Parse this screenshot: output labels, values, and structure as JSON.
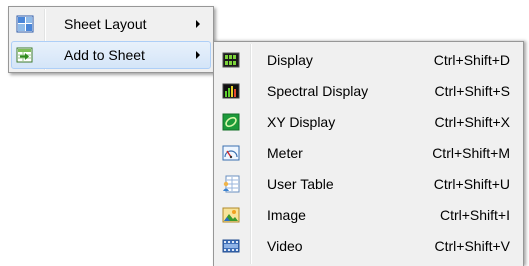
{
  "main_menu": {
    "items": [
      {
        "label": "Sheet Layout",
        "icon": "sheet-layout-icon",
        "has_submenu": true
      },
      {
        "label": "Add to Sheet",
        "icon": "add-to-sheet-icon",
        "has_submenu": true,
        "highlighted": true
      }
    ]
  },
  "submenu": {
    "items": [
      {
        "label": "Display",
        "shortcut": "Ctrl+Shift+D",
        "icon": "display-icon"
      },
      {
        "label": "Spectral Display",
        "shortcut": "Ctrl+Shift+S",
        "icon": "spectral-display-icon"
      },
      {
        "label": "XY Display",
        "shortcut": "Ctrl+Shift+X",
        "icon": "xy-display-icon"
      },
      {
        "label": "Meter",
        "shortcut": "Ctrl+Shift+M",
        "icon": "meter-icon"
      },
      {
        "label": "User Table",
        "shortcut": "Ctrl+Shift+U",
        "icon": "user-table-icon"
      },
      {
        "label": "Image",
        "shortcut": "Ctrl+Shift+I",
        "icon": "image-icon"
      },
      {
        "label": "Video",
        "shortcut": "Ctrl+Shift+V",
        "icon": "video-icon"
      }
    ]
  },
  "colors": {
    "menu_background": "#f0f0f0",
    "menu_border": "#979797",
    "highlight_top": "#e8f1fb",
    "highlight_bottom": "#d4e5f8",
    "highlight_border": "#aecff7"
  }
}
